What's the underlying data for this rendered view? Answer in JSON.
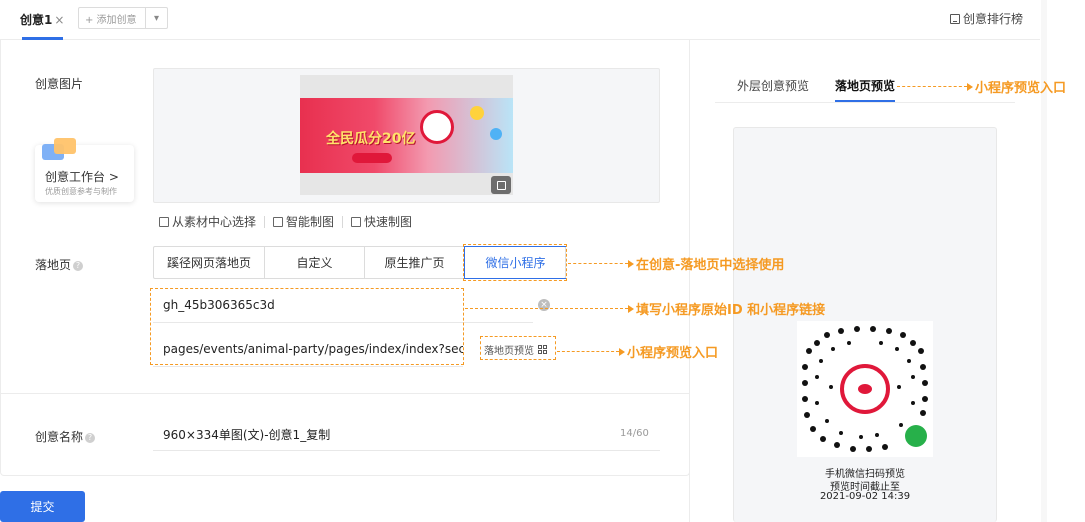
{
  "header": {
    "tab_label": "创意1",
    "tab_close": "×",
    "add_label": "+ 添加创意",
    "add_chevron": "▾",
    "rank_label": "创意排行榜"
  },
  "form": {
    "image_label": "创意图片",
    "workbench_title": "创意工作台 >",
    "workbench_sub": "优质创意参考与制作",
    "tools": [
      "从素材中心选择",
      "智能制图",
      "快速制图"
    ],
    "landing_label": "落地页",
    "landing_options": [
      "蹊径网页落地页",
      "自定义",
      "原生推广页",
      "微信小程序"
    ],
    "landing_active_index": 3,
    "miniprogram_id": "gh_45b306365c3d",
    "miniprogram_path": "pages/events/animal-party/pages/index/index?second",
    "landing_preview_label": "落地页预览",
    "clear_icon": "×",
    "name_label": "创意名称",
    "name_value": "960×334单图(文)-创意1_复制",
    "name_counter": "14/60",
    "submit_label": "提交"
  },
  "preview": {
    "tab_outer": "外层创意预览",
    "tab_landing": "落地页预览",
    "qr_caption_1": "手机微信扫码预览",
    "qr_caption_2": "预览时间截止至",
    "qr_caption_3": "2021-09-02 14:39"
  },
  "annotations": {
    "preview_entry_top": "小程序预览入口",
    "select_in_landing": "在创意-落地页中选择使用",
    "fill_id_link": "填写小程序原始ID 和小程序链接",
    "preview_entry_mid": "小程序预览入口"
  },
  "banner": {
    "headline": "全民瓜分20亿"
  },
  "colors": {
    "accent": "#2f6fe6",
    "annotation": "#f59a23"
  }
}
